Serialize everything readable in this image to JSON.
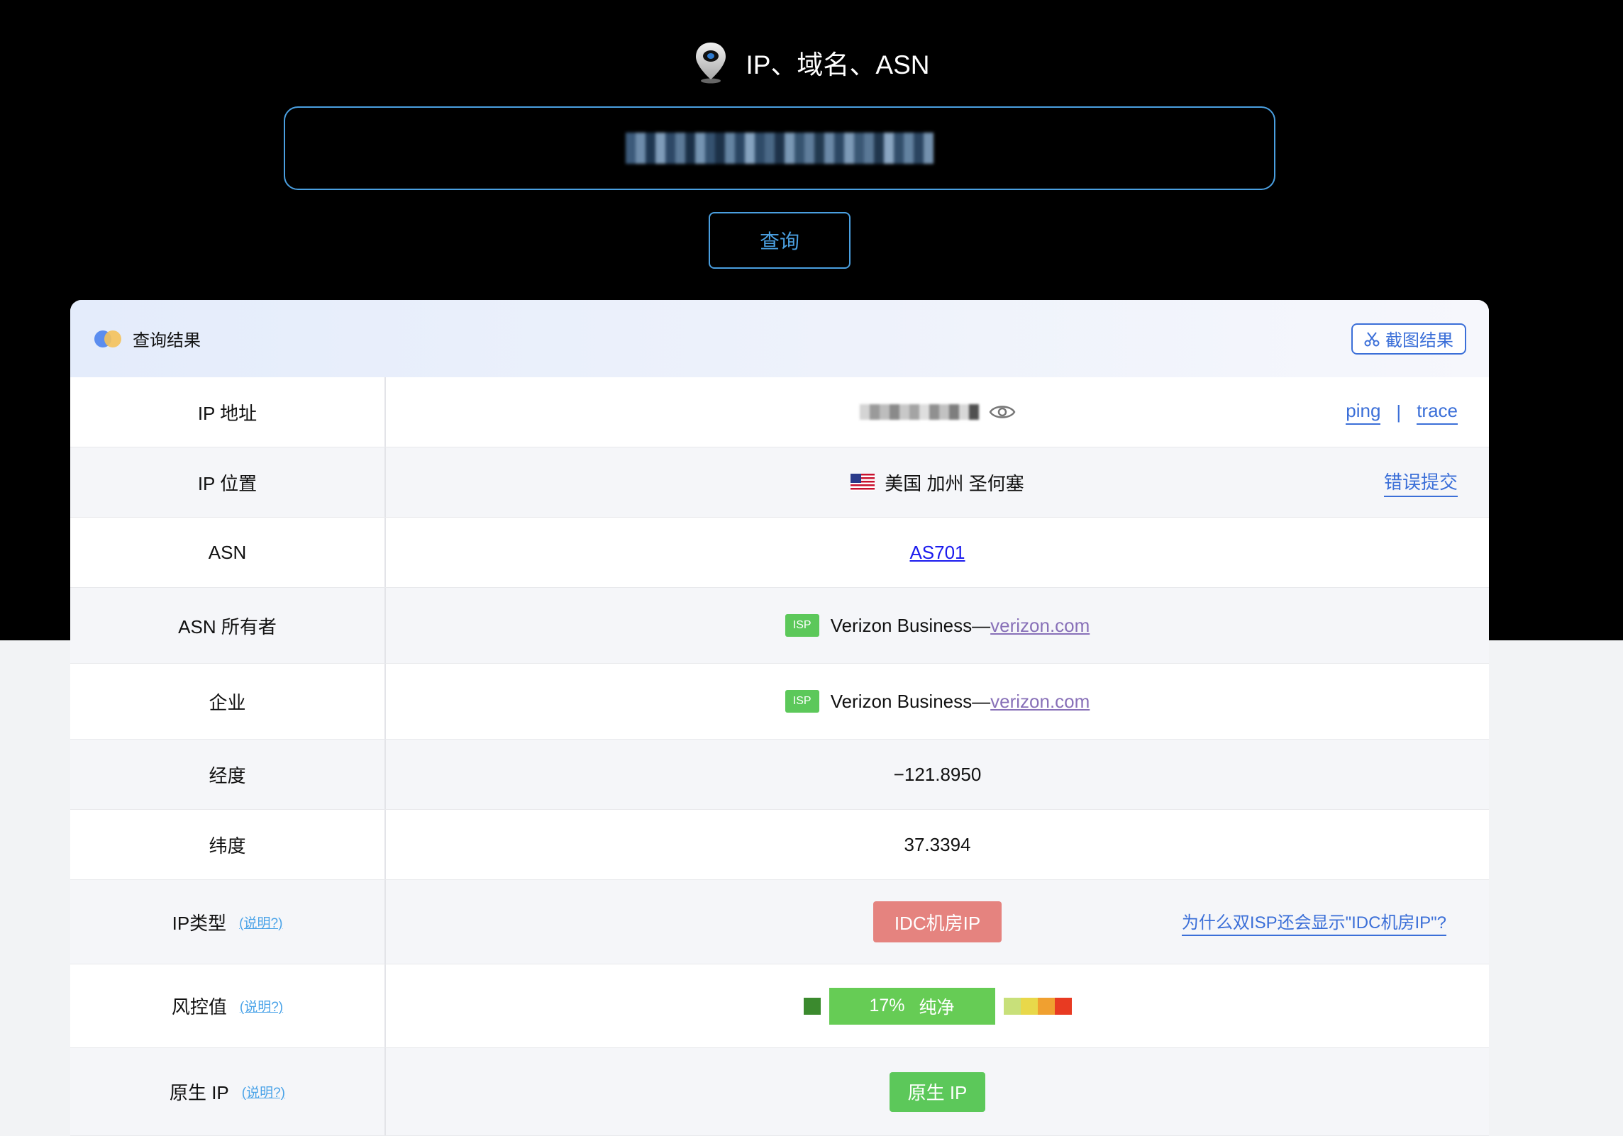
{
  "header": {
    "title": "IP、域名、ASN",
    "query_button": "查询"
  },
  "card": {
    "title": "查询结果",
    "screenshot_button": "截图结果"
  },
  "rows": {
    "ip_address": {
      "label": "IP 地址",
      "ping": "ping",
      "separator": "|",
      "trace": "trace"
    },
    "ip_location": {
      "label": "IP 位置",
      "value": "美国 加州 圣何塞",
      "report": "错误提交"
    },
    "asn": {
      "label": "ASN",
      "value": "AS701"
    },
    "asn_owner": {
      "label": "ASN 所有者",
      "badge": "ISP",
      "name": "Verizon Business—",
      "domain": "verizon.com"
    },
    "company": {
      "label": "企业",
      "badge": "ISP",
      "name": "Verizon Business—",
      "domain": "verizon.com"
    },
    "longitude": {
      "label": "经度",
      "value": "−121.8950"
    },
    "latitude": {
      "label": "纬度",
      "value": "37.3394"
    },
    "ip_type": {
      "label": "IP类型",
      "help": "(说明?)",
      "value": "IDC机房IP",
      "why": "为什么双ISP还会显示\"IDC机房IP\"?"
    },
    "risk": {
      "label": "风控值",
      "help": "(说明?)",
      "percent": "17%",
      "status": "纯净"
    },
    "native_ip": {
      "label": "原生 IP",
      "help": "(说明?)",
      "value": "原生 IP"
    }
  },
  "colors": {
    "accent": "#4a9fe0",
    "link": "#3b6fd8",
    "isp_green": "#5cc85a",
    "idc_red": "#e5837f"
  }
}
